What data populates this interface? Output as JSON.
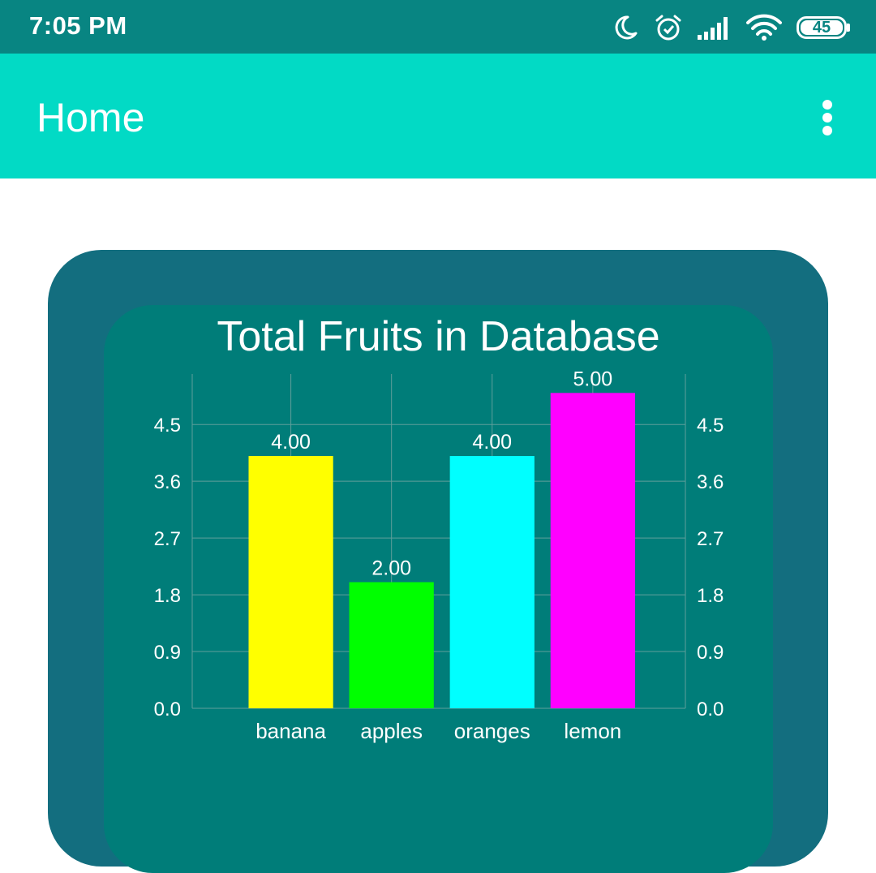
{
  "status_bar": {
    "time": "7:05 PM",
    "battery": "45",
    "icons": [
      "moon-icon",
      "alarm-icon",
      "signal-icon",
      "wifi-icon",
      "battery-icon"
    ]
  },
  "app_bar": {
    "title": "Home",
    "overflow_icon": "more-vert-icon"
  },
  "colors": {
    "status_bar": "#088582",
    "app_bar": "#02dac5",
    "card_outer": "#136e7f",
    "card_inner": "#007d79"
  },
  "chart_data": {
    "type": "bar",
    "title": "Total Fruits in Database",
    "categories": [
      "banana",
      "apples",
      "oranges",
      "lemon"
    ],
    "values": [
      4,
      2,
      4,
      5
    ],
    "value_labels": [
      "4.00",
      "2.00",
      "4.00",
      "5.00"
    ],
    "colors": [
      "#ffff00",
      "#00ff00",
      "#00ffff",
      "#ff00ff"
    ],
    "ylim": [
      0,
      5.3
    ],
    "yticks": [
      "0.0",
      "0.9",
      "1.8",
      "2.7",
      "3.6",
      "4.5"
    ],
    "ytick_values": [
      0,
      0.9,
      1.8,
      2.7,
      3.6,
      4.5
    ],
    "grid": true,
    "dual_y_axis": true,
    "legend": "none"
  }
}
